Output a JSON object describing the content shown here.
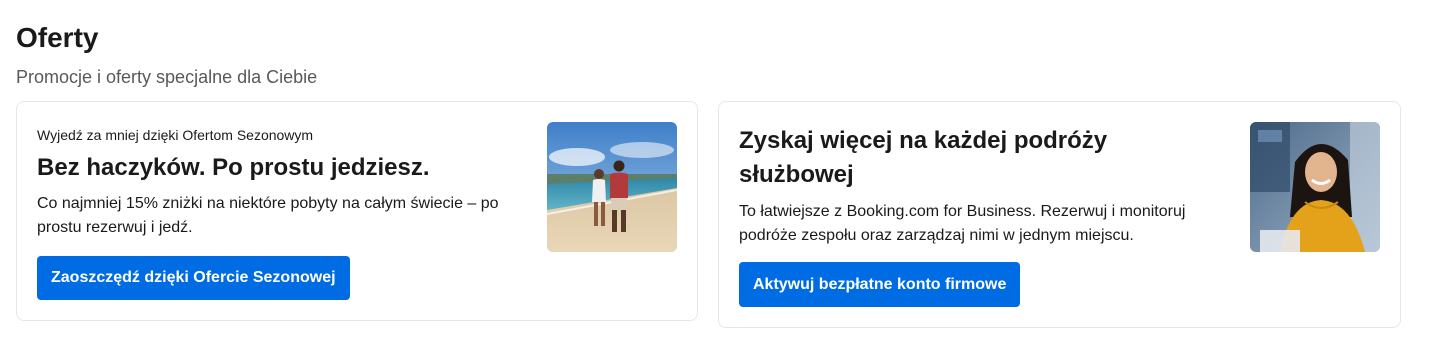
{
  "section": {
    "title": "Oferty",
    "subtitle": "Promocje i oferty specjalne dla Ciebie"
  },
  "cards": [
    {
      "eyebrow": "Wyjedź za mniej dzięki Ofertom Sezonowym",
      "heading": "Bez haczyków. Po prostu jedziesz.",
      "text": "Co najmniej 15% zniżki na niektóre pobyty na całym świecie – po prostu rezerwuj i jedź.",
      "button_label": "Zaoszczędź dzięki Ofercie Sezonowej",
      "image": "beach-couple-photo"
    },
    {
      "heading": "Zyskaj więcej na każdej podróży służbowej",
      "text": "To łatwiejsze z Booking.com for Business. Rezerwuj i monitoruj podróże zespołu oraz zarządzaj nimi w jednym miejscu.",
      "button_label": "Aktywuj bezpłatne konto firmowe",
      "image": "business-woman-photo"
    }
  ],
  "colors": {
    "accent": "#006ce4",
    "card_border": "#e7e7e7",
    "subtitle": "#595959"
  }
}
